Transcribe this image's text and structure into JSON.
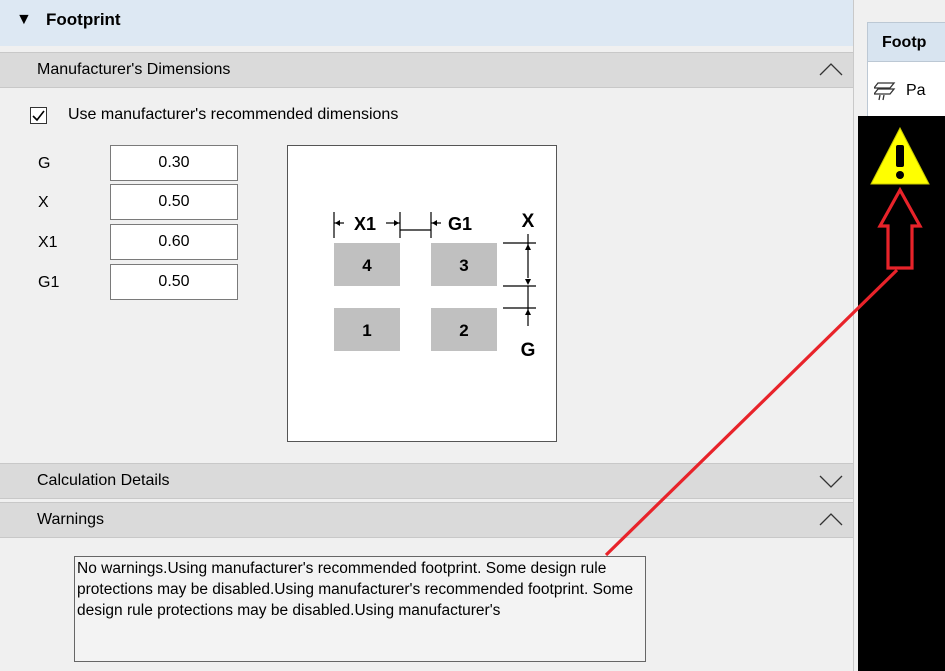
{
  "footprint": {
    "title": "Footprint"
  },
  "manufacturer_section": {
    "label": "Manufacturer's Dimensions",
    "checkbox_label": "Use manufacturer's recommended dimensions",
    "checked": true,
    "params": [
      {
        "label": "G",
        "value": "0.30"
      },
      {
        "label": "X",
        "value": "0.50"
      },
      {
        "label": "X1",
        "value": "0.60"
      },
      {
        "label": "G1",
        "value": "0.50"
      }
    ],
    "diagram": {
      "pads": [
        "4",
        "3",
        "1",
        "2"
      ],
      "dim_labels": {
        "x1": "X1",
        "g1": "G1",
        "x": "X",
        "g": "G"
      }
    }
  },
  "calculation_section": {
    "label": "Calculation Details"
  },
  "warnings_section": {
    "label": "Warnings",
    "text": "No warnings.Using manufacturer's recommended footprint. Some design rule protections may be disabled.Using manufacturer's recommended footprint. Some design rule protections may be disabled.Using manufacturer's"
  },
  "right_panel": {
    "tab_label": "Footp",
    "toolbar_label": "Pa"
  },
  "colors": {
    "header_bg": "#dde8f3",
    "section_bg": "#dadada",
    "pad_fill": "#c0c0c0",
    "warning_yellow": "#ffff00",
    "annotation_red": "#e8232a"
  }
}
